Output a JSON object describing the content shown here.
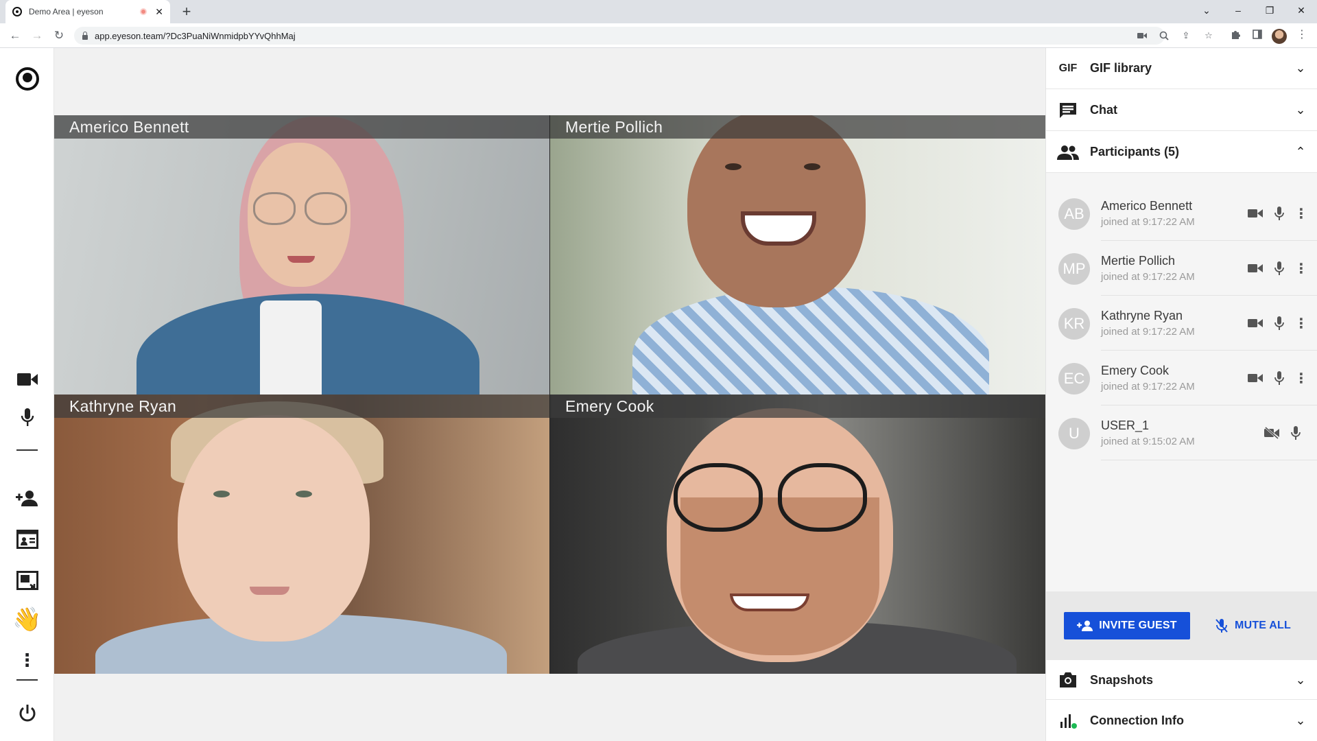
{
  "browser": {
    "tab_title": "Demo Area | eyeson",
    "new_tab": "+",
    "url": "app.eyeson.team/?Dc3PuaNiWnmidpbYYvQhhMaj"
  },
  "tiles": [
    {
      "name": "Americo Bennett"
    },
    {
      "name": "Mertie Pollich"
    },
    {
      "name": "Kathryne Ryan"
    },
    {
      "name": "Emery Cook"
    }
  ],
  "panel": {
    "gif": {
      "icon_text": "GIF",
      "label": "GIF library"
    },
    "chat": {
      "label": "Chat"
    },
    "participants": {
      "label": "Participants (5)"
    },
    "snapshots": {
      "label": "Snapshots"
    },
    "connection": {
      "label": "Connection Info"
    }
  },
  "participants": [
    {
      "initials": "AB",
      "name": "Americo Bennett",
      "joined": "joined at 9:17:22 AM"
    },
    {
      "initials": "MP",
      "name": "Mertie Pollich",
      "joined": "joined at 9:17:22 AM"
    },
    {
      "initials": "KR",
      "name": "Kathryne Ryan",
      "joined": "joined at 9:17:22 AM"
    },
    {
      "initials": "EC",
      "name": "Emery Cook",
      "joined": "joined at 9:17:22 AM"
    },
    {
      "initials": "U",
      "name": "USER_1",
      "joined": "joined at 9:15:02 AM"
    }
  ],
  "actions": {
    "invite": "INVITE GUEST",
    "mute_all": "MUTE ALL"
  },
  "colors": {
    "accent": "#1650d9",
    "status_green": "#1db954"
  }
}
